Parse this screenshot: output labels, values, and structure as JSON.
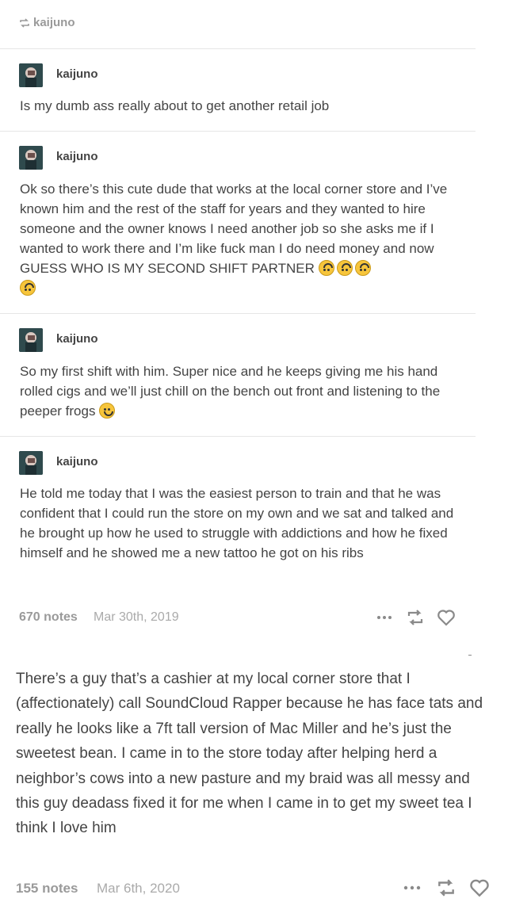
{
  "reblog_header": {
    "username": "kaijuno"
  },
  "posts": [
    {
      "username": "kaijuno",
      "text": "Is my dumb ass really about to get another retail job"
    },
    {
      "username": "kaijuno",
      "text": "Ok so there’s this cute dude that works at the local corner store and I’ve known him and the rest of the staff for years and they wanted to hire someone and the owner knows I need another job so she asks me if I wanted to work there and I’m like fuck man I do need money and now GUESS WHO IS MY SECOND SHIFT PARTNER"
    },
    {
      "username": "kaijuno",
      "text": "So my first shift with him. Super nice and he keeps giving me his hand rolled cigs and we’ll just chill on the bench out front and listening to the peeper frogs"
    },
    {
      "username": "kaijuno",
      "text": "He told me today that I was the easiest person to train and that he was confident that I could run the store on my own and we sat and talked and he brought up how he used to struggle with addictions and how he fixed himself and he showed me a new tattoo he got on his ribs"
    }
  ],
  "footer1": {
    "notes": "670 notes",
    "date": "Mar 30th, 2019"
  },
  "second_post": {
    "text": "There’s a guy that’s a cashier at my local corner store that I (affectionately) call SoundCloud Rapper because he has face tats and really he looks like a 7ft tall version of Mac Miller and he’s just the sweetest bean. I came in to the store today after helping herd a neighbor’s cows into a new pasture and my braid was all messy and this guy deadass fixed it for me when I came in to get my sweet tea I think I love him"
  },
  "footer2": {
    "notes": "155 notes",
    "date": "Mar 6th, 2020"
  },
  "icons": {
    "reblog": "reblog-icon",
    "more": "more-icon",
    "like": "heart-icon",
    "emoji_upside_down": "upside-down-face-icon",
    "emoji_smile": "relieved-face-icon"
  }
}
